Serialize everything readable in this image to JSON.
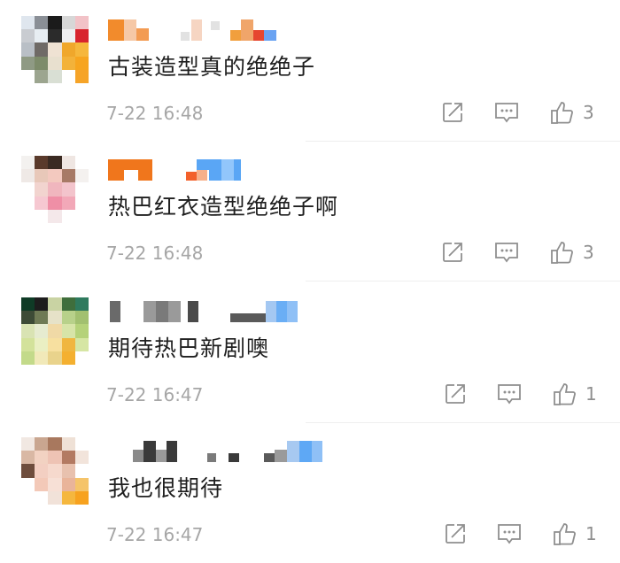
{
  "comments": [
    {
      "text": "古装造型真的绝绝子",
      "time": "7-22 16:48",
      "likes": "3",
      "avatar_colors": [
        "#dfe6ee",
        "#8a8f96",
        "#1b1b1b",
        "#d7d7d7",
        "#f2c2c7",
        "#c9ccd1",
        "#e7edf2",
        "#2b2b2b",
        "#efeff1",
        "#d8242e",
        "#b9bfc6",
        "#6f6a66",
        "#efe2d3",
        "#f0a72b",
        "#f6b73c",
        "#8f9a84",
        "#7d8b6a",
        "#e8e0cf",
        "#f3b23a",
        "#f7a51f",
        "#ffffff",
        "#9ca58f",
        "#d9dfd4",
        "#ffffff",
        "#f6a428"
      ],
      "name_colors": [
        "#f28b2c",
        "#f6c8a6",
        "#f0a56a",
        "#f6d5c2",
        "#f39b52",
        "#e2e2e2",
        "#f19f3d",
        "#e6462f",
        "#6aa3f2"
      ]
    },
    {
      "text": "热巴红衣造型绝绝子啊",
      "time": "7-22 16:48",
      "likes": "3",
      "avatar_colors": [
        "#f3f1ef",
        "#5a3a2b",
        "#3a2a22",
        "#efe6e2",
        "#ffffff",
        "#efe9e6",
        "#e8c8b9",
        "#f3c9bf",
        "#a77a66",
        "#f4f1ef",
        "#ffffff",
        "#f2d4cf",
        "#f0b6be",
        "#f3c4cc",
        "#ffffff",
        "#ffffff",
        "#f6c8d1",
        "#ef8fa6",
        "#f2a8b8",
        "#ffffff",
        "#ffffff",
        "#ffffff",
        "#f4e8ea",
        "#ffffff",
        "#ffffff"
      ],
      "name_colors": [
        "#f0761c",
        "#f0761c",
        "#f0761c",
        "#e8e8e8",
        "#f3612b",
        "#f7b08a",
        "#5aa6f5",
        "#92c6fb"
      ]
    },
    {
      "text": "期待热巴新剧噢",
      "time": "7-22 16:47",
      "likes": "1",
      "avatar_colors": [
        "#0f3b26",
        "#1d1d1d",
        "#c9d3a3",
        "#3f6e3c",
        "#2f7a5e",
        "#3d4b36",
        "#6f7a55",
        "#e6e2c8",
        "#b8d18a",
        "#a2c070",
        "#d9e3b3",
        "#e6ebd0",
        "#f0d9a6",
        "#d7e4a8",
        "#b5d27a",
        "#d3e29b",
        "#eaefc3",
        "#f7e0a0",
        "#f0b640",
        "#d6e6a4",
        "#c3da8a",
        "#f1e9b9",
        "#e9d38c",
        "#f4b030",
        "#ffffff"
      ],
      "name_colors": [
        "#3a3a3a",
        "#9a9a9a",
        "#3a3a3a",
        "#6a6a6a",
        "#3a3a3a",
        "#5a5a5a",
        "#a4c8f2",
        "#6aaef5"
      ]
    },
    {
      "text": "我也很期待",
      "time": "7-22 16:47",
      "likes": "1",
      "avatar_colors": [
        "#f1e8e2",
        "#c9a690",
        "#a8785e",
        "#efe1d6",
        "#ffffff",
        "#d9b8a4",
        "#f2d2c2",
        "#eec3b4",
        "#b37a62",
        "#f2e4db",
        "#6e4d3d",
        "#f3cfc2",
        "#f6d9cd",
        "#e8c1ae",
        "#ffffff",
        "#ffffff",
        "#f3c9b8",
        "#f7e0d6",
        "#e9b49a",
        "#f5c46a",
        "#ffffff",
        "#ffffff",
        "#f1e2d9",
        "#f5b73e",
        "#f7a21f"
      ],
      "name_colors": [
        "#8a8a8a",
        "#3a3a3a",
        "#9a9a9a",
        "#3a3a3a",
        "#7a7a7a",
        "#3a3a3a",
        "#9a9a9a",
        "#a7c9f1",
        "#5ea8f5"
      ]
    }
  ],
  "icons": {
    "share": "share-icon",
    "reply": "comment-icon",
    "like": "thumbs-up-icon"
  }
}
